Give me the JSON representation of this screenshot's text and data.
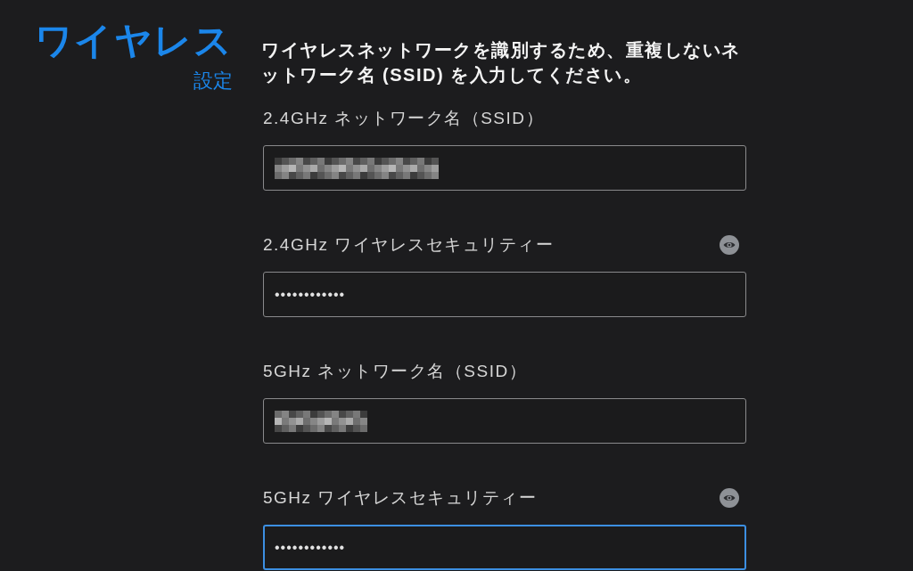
{
  "header": {
    "title": "ワイヤレス",
    "subtitle": "設定"
  },
  "description": "ワイヤレスネットワークを識別するため、重複しないネットワーク名 (SSID) を入力してください。",
  "fields": [
    {
      "kind": "ssid",
      "label": "2.4GHz ネットワーク名（SSID）",
      "focused": false
    },
    {
      "kind": "password",
      "label": "2.4GHz ワイヤレスセキュリティー",
      "value": "••••••••••••",
      "focused": false
    },
    {
      "kind": "ssid",
      "label": "5GHz ネットワーク名（SSID）",
      "focused": false
    },
    {
      "kind": "password",
      "label": "5GHz ワイヤレスセキュリティー",
      "value": "••••••••••••",
      "focused": true
    }
  ]
}
